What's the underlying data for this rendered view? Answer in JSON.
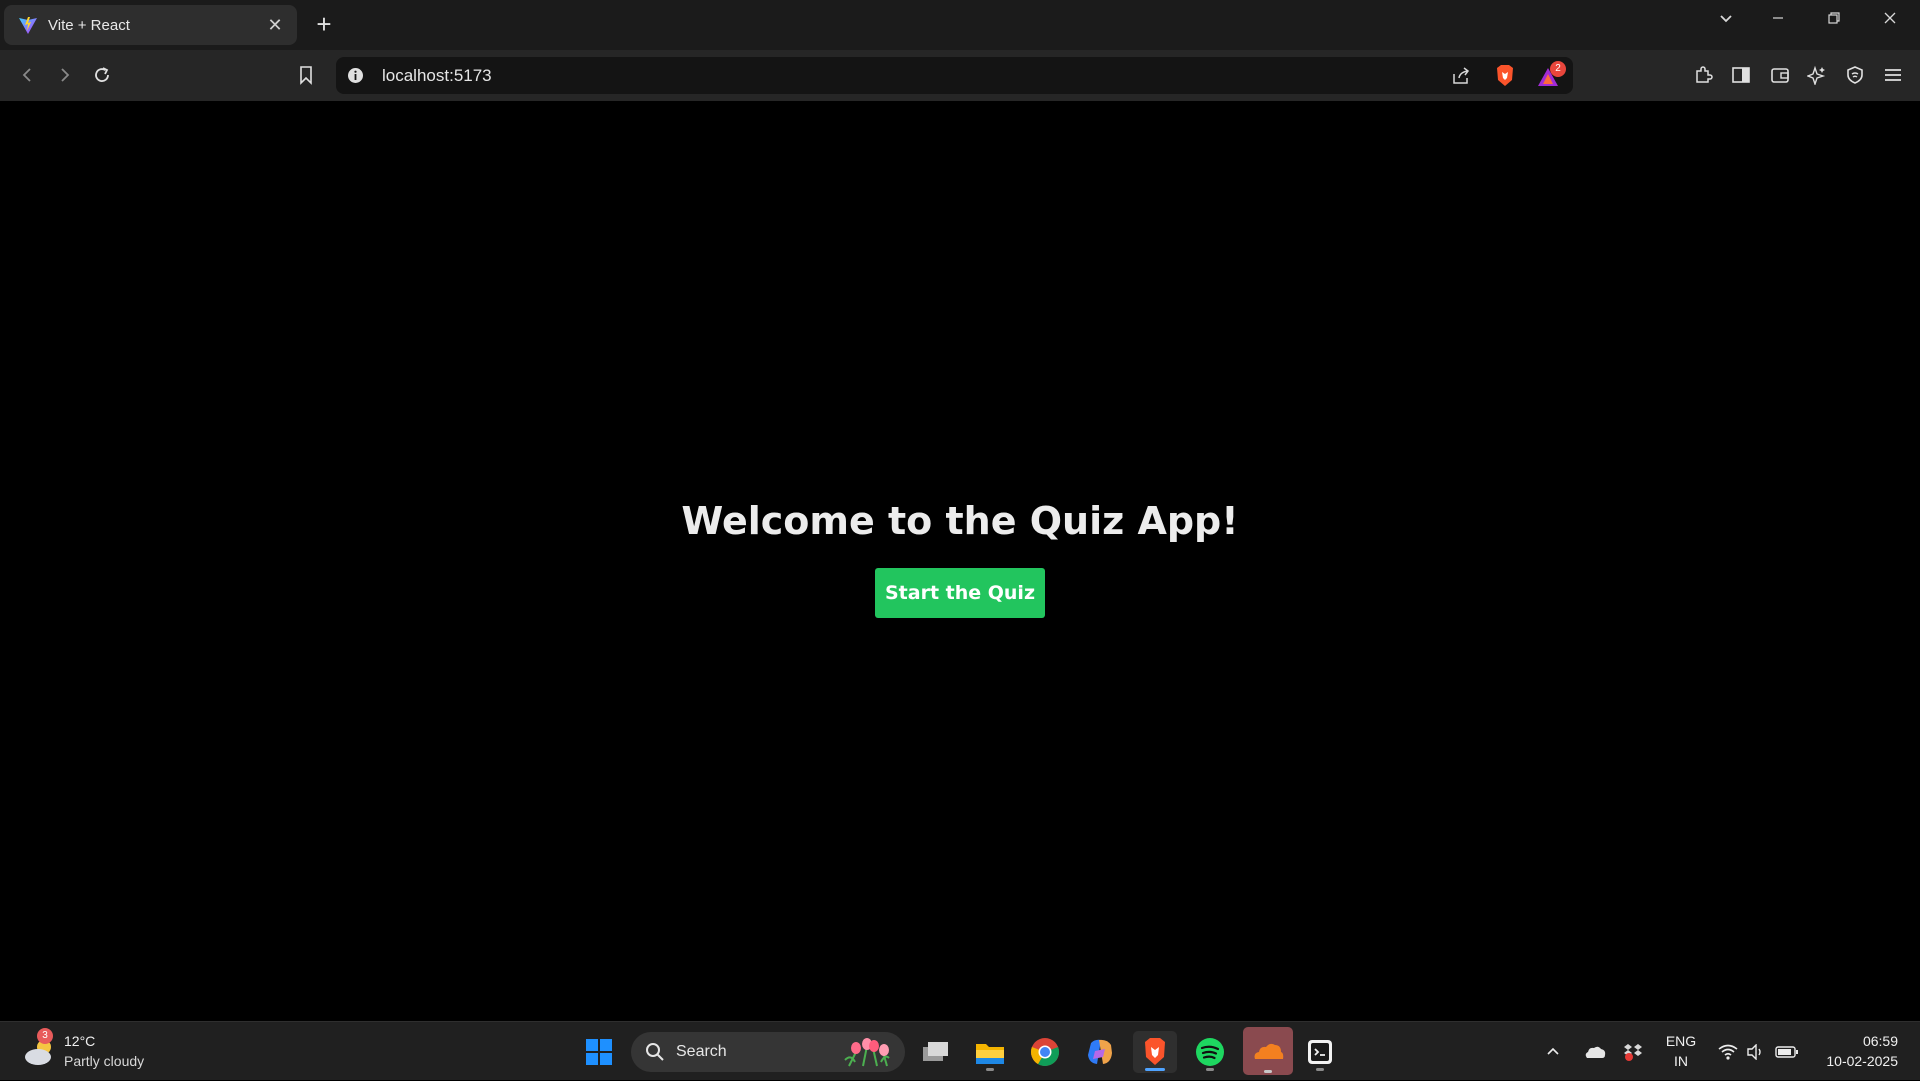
{
  "browser": {
    "tab_title": "Vite + React",
    "url": "localhost:5173",
    "notification_count": "2"
  },
  "page": {
    "heading": "Welcome to the Quiz App!",
    "start_button": "Start the Quiz",
    "accent_color": "#22c55e"
  },
  "taskbar": {
    "weather_temp": "12°C",
    "weather_condition": "Partly cloudy",
    "weather_badge": "3",
    "search_label": "Search",
    "language_line1": "ENG",
    "language_line2": "IN",
    "time": "06:59",
    "date": "10-02-2025"
  }
}
